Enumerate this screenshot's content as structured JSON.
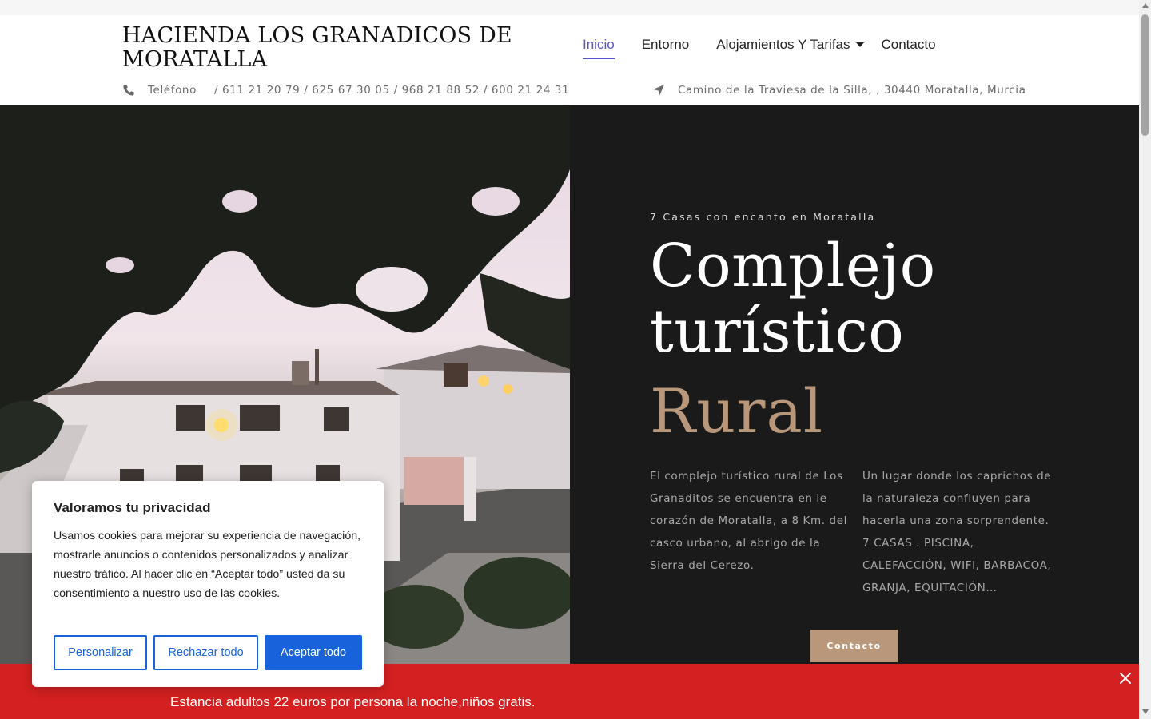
{
  "site": {
    "title": "HACIENDA LOS GRANADICOS DE MORATALLA"
  },
  "nav": {
    "items": [
      {
        "label": "Inicio"
      },
      {
        "label": "Entorno"
      },
      {
        "label": "Alojamientos Y Tarifas"
      },
      {
        "label": "Contacto"
      }
    ]
  },
  "contact_info": {
    "phone_label": "Teléfono",
    "phone_numbers": "/ 611 21 20 79 / 625 67 30 05 / 968 21 88 52 / 600 21 24 31",
    "address": "Camino de la Traviesa de la Silla, , 30440 Moratalla, Murcia"
  },
  "hero": {
    "kicker": "7 Casas con encanto en Moratalla",
    "headline_line1": "Complejo",
    "headline_line2": "turístico",
    "headline_accent": "Rural",
    "paragraph_1": "El complejo turístico rural de Los Granaditos se encuentra en le corazón de Moratalla, a 8 Km. del casco urbano, al abrigo de la Sierra del Cerezo.",
    "paragraph_2": "Un lugar donde los caprichos de la naturaleza confluyen para hacerla una zona sorprendente. 7 CASAS . PISCINA, CALEFACCIÓN, WIFI, BARBACOA, GRANJA, EQUITACIÓN…",
    "cta_label": "Contacto"
  },
  "notice": {
    "text": "Estancia adultos 22 euros por persona la noche,niños gratis."
  },
  "cookie": {
    "title": "Valoramos tu privacidad",
    "body": "Usamos cookies para mejorar su experiencia de navegación, mostrarle anuncios o contenidos personalizados y analizar nuestro tráfico. Al hacer clic en “Aceptar todo” usted da su consentimiento a nuestro uso de las cookies.",
    "customize_label": "Personalizar",
    "reject_label": "Rechazar todo",
    "accept_label": "Aceptar todo"
  },
  "colors": {
    "accent_gold": "#b8977a",
    "nav_active": "#5a55c9",
    "notice_red": "#d42020",
    "cookie_blue": "#1863dc",
    "hero_dark": "#1a1a1a"
  }
}
